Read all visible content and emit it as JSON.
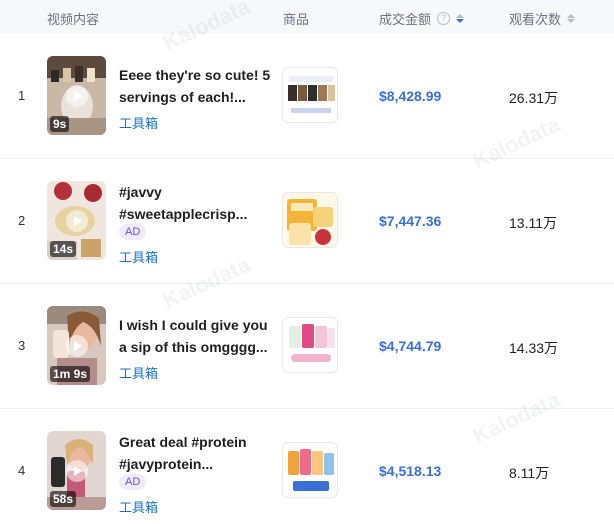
{
  "header": {
    "video": "视频内容",
    "product": "商品",
    "sales": "成交金额",
    "views": "观看次数"
  },
  "watermark": "Kalodata",
  "rows": [
    {
      "rank": "1",
      "duration": "9s",
      "title_line1": "Eeee they're so cute! 5",
      "title_line2": "servings of each!...",
      "ad": "",
      "shop": "工具箱",
      "sales": "$8,428.99",
      "views": "26.31万"
    },
    {
      "rank": "2",
      "duration": "14s",
      "title_line1": "#javvy",
      "title_line2": "#sweetapplecrisp...",
      "ad": "AD",
      "shop": "工具箱",
      "sales": "$7,447.36",
      "views": "13.11万"
    },
    {
      "rank": "3",
      "duration": "1m 9s",
      "title_line1": "I wish I could give you",
      "title_line2": "a sip of this omgggg...",
      "ad": "",
      "shop": "工具箱",
      "sales": "$4,744.79",
      "views": "14.33万"
    },
    {
      "rank": "4",
      "duration": "58s",
      "title_line1": "Great deal #protein",
      "title_line2": "#javyprotein...",
      "ad": "AD",
      "shop": "工具箱",
      "sales": "$4,518.13",
      "views": "8.11万"
    }
  ],
  "icons": {
    "info": "info-circle-icon",
    "sort": "sort-icon",
    "play": "play-icon"
  },
  "colors": {
    "accent": "#3b6fd6",
    "link": "#1a73c8",
    "ad": "#6b4fd8"
  }
}
